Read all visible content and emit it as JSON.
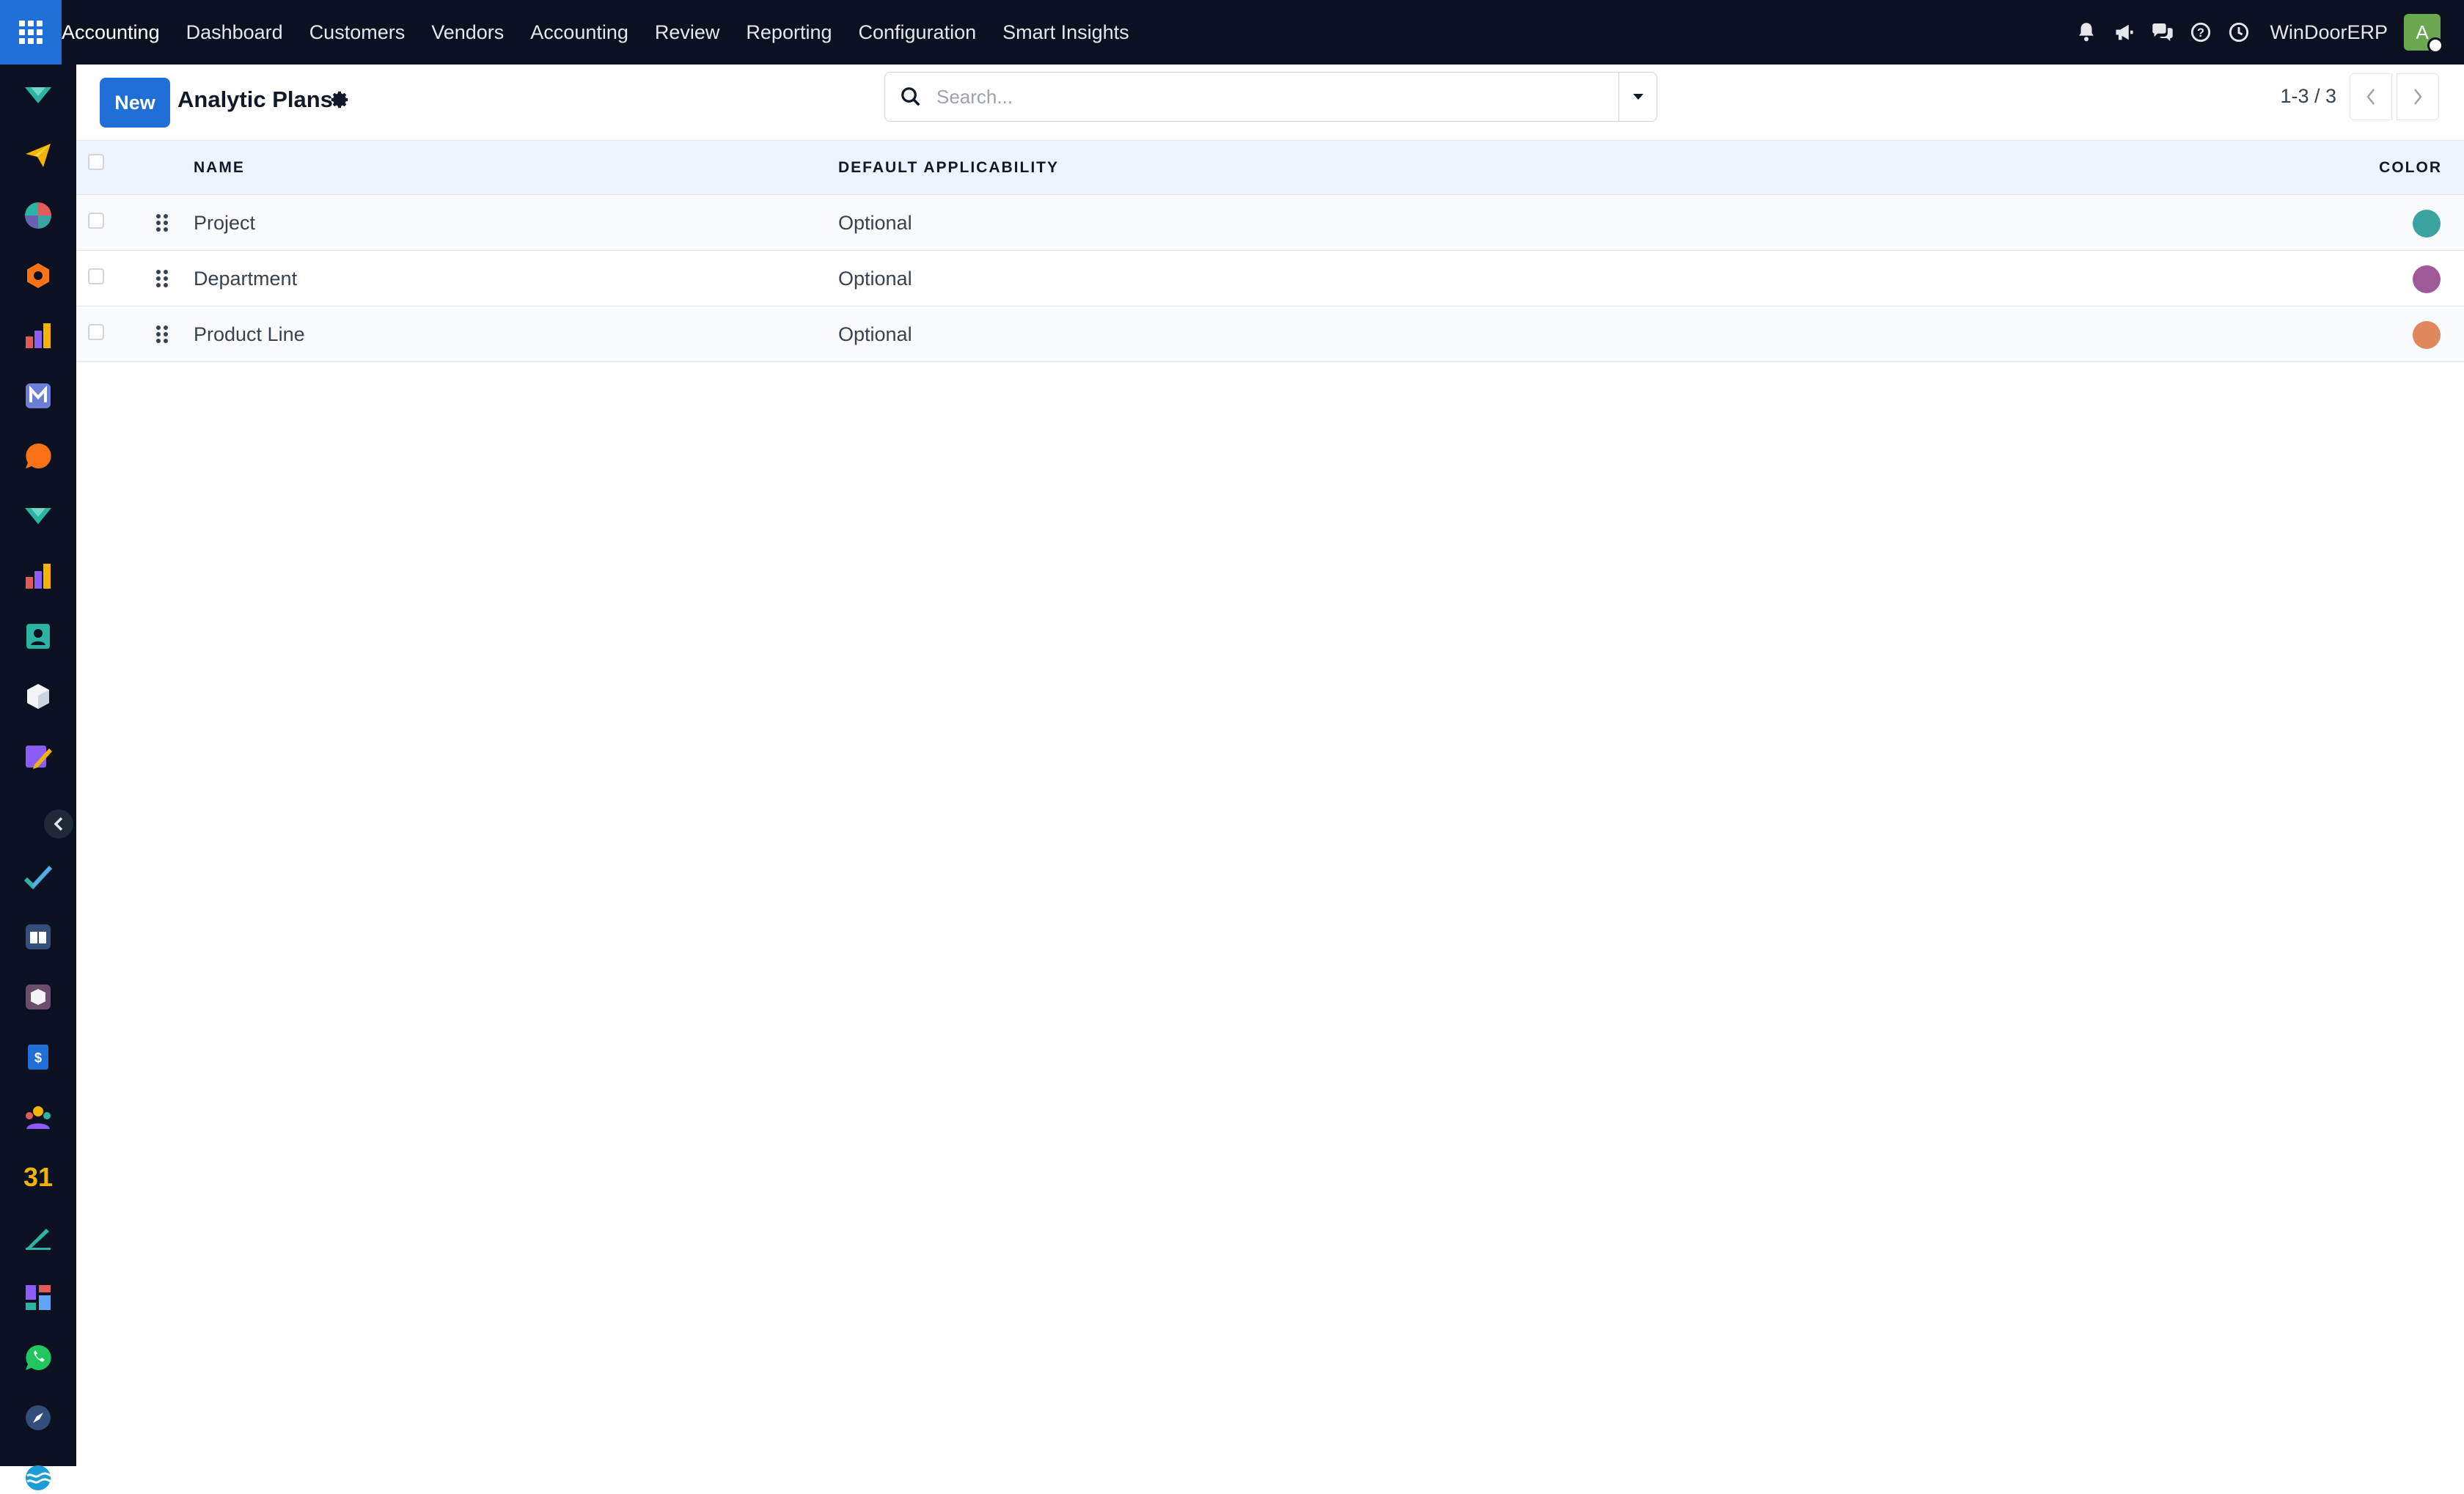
{
  "topbar": {
    "app_name": "Accounting",
    "menu": [
      "Dashboard",
      "Customers",
      "Vendors",
      "Accounting",
      "Review",
      "Reporting",
      "Configuration",
      "Smart Insights"
    ],
    "company": "WinDoorERP",
    "avatar_letter": "A",
    "icons": [
      "bell-icon",
      "megaphone-icon",
      "chat-icon",
      "help-icon",
      "clock-icon"
    ]
  },
  "siderail": {
    "apps": [
      "discuss-icon",
      "send-icon",
      "pie-icon",
      "hex-icon",
      "chart-icon",
      "mail-icon",
      "bubble-icon",
      "discuss-icon",
      "chart-icon",
      "contacts-icon",
      "cube-icon",
      "pencil-icon",
      "check-icon",
      "book-icon",
      "box-icon",
      "invoice-icon",
      "team-icon",
      "calendar-icon",
      "sign-icon",
      "dashboard-icon",
      "whatsapp-icon",
      "compass-icon",
      "wave-icon"
    ],
    "calendar_text": "31"
  },
  "control": {
    "new_label": "New",
    "title": "Analytic Plans",
    "search_placeholder": "Search...",
    "pager": "1-3 / 3"
  },
  "table": {
    "headers": {
      "name": "NAME",
      "applicability": "DEFAULT APPLICABILITY",
      "color": "COLOR"
    },
    "rows": [
      {
        "name": "Project",
        "applicability": "Optional",
        "color": "#3aa39f"
      },
      {
        "name": "Department",
        "applicability": "Optional",
        "color": "#a05a98"
      },
      {
        "name": "Product Line",
        "applicability": "Optional",
        "color": "#e0875e"
      }
    ]
  },
  "colors": {
    "navbar": "#0b1120",
    "primary": "#1f6fd6",
    "header_bg": "#eef4fd"
  }
}
